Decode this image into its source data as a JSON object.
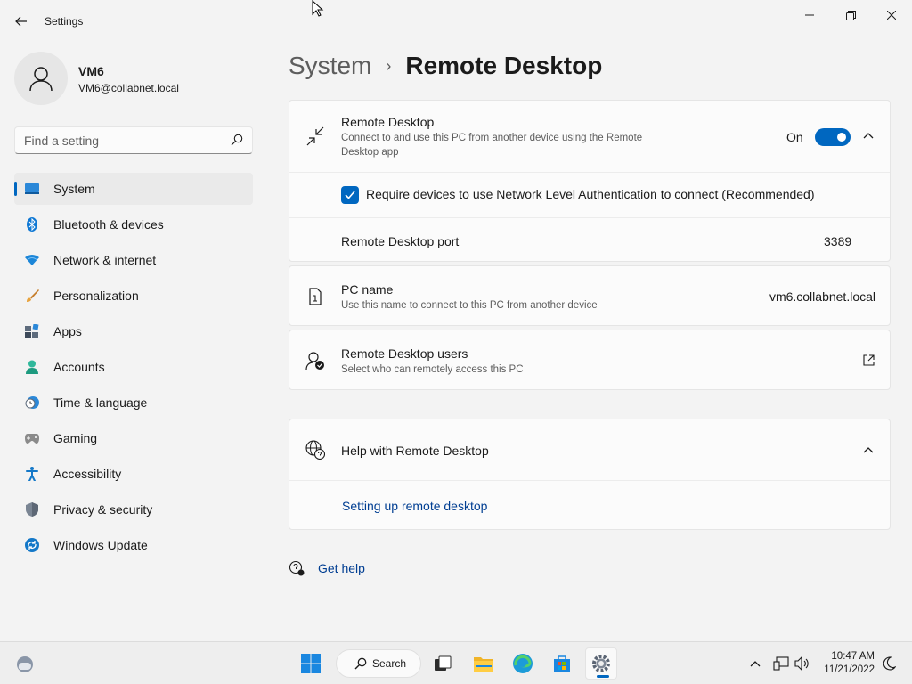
{
  "window": {
    "title": "Settings"
  },
  "profile": {
    "name": "VM6",
    "email": "VM6@collabnet.local"
  },
  "search": {
    "placeholder": "Find a setting"
  },
  "sidebar": {
    "items": [
      {
        "label": "System",
        "icon": "system-icon",
        "selected": true
      },
      {
        "label": "Bluetooth & devices",
        "icon": "bluetooth-icon"
      },
      {
        "label": "Network & internet",
        "icon": "wifi-icon"
      },
      {
        "label": "Personalization",
        "icon": "brush-icon"
      },
      {
        "label": "Apps",
        "icon": "apps-icon"
      },
      {
        "label": "Accounts",
        "icon": "accounts-icon"
      },
      {
        "label": "Time & language",
        "icon": "clock-globe-icon"
      },
      {
        "label": "Gaming",
        "icon": "gamepad-icon"
      },
      {
        "label": "Accessibility",
        "icon": "accessibility-icon"
      },
      {
        "label": "Privacy & security",
        "icon": "shield-icon"
      },
      {
        "label": "Windows Update",
        "icon": "update-icon"
      }
    ]
  },
  "breadcrumb": {
    "parent": "System",
    "separator": "›",
    "current": "Remote Desktop"
  },
  "remote_desktop": {
    "title": "Remote Desktop",
    "description": "Connect to and use this PC from another device using the Remote Desktop app",
    "toggle_label": "On",
    "toggle_on": true,
    "nla_label": "Require devices to use Network Level Authentication to connect (Recommended)",
    "nla_checked": true,
    "port_label": "Remote Desktop port",
    "port_value": "3389"
  },
  "pc_name": {
    "title": "PC name",
    "description": "Use this name to connect to this PC from another device",
    "value": "vm6.collabnet.local"
  },
  "rd_users": {
    "title": "Remote Desktop users",
    "description": "Select who can remotely access this PC"
  },
  "help": {
    "title": "Help with Remote Desktop",
    "link": "Setting up remote desktop"
  },
  "get_help": {
    "label": "Get help"
  },
  "taskbar": {
    "search_label": "Search",
    "time": "10:47 AM",
    "date": "11/21/2022"
  },
  "colors": {
    "accent": "#0067c0",
    "link": "#003e92",
    "background": "#f3f3f3",
    "card": "#fbfbfb"
  }
}
